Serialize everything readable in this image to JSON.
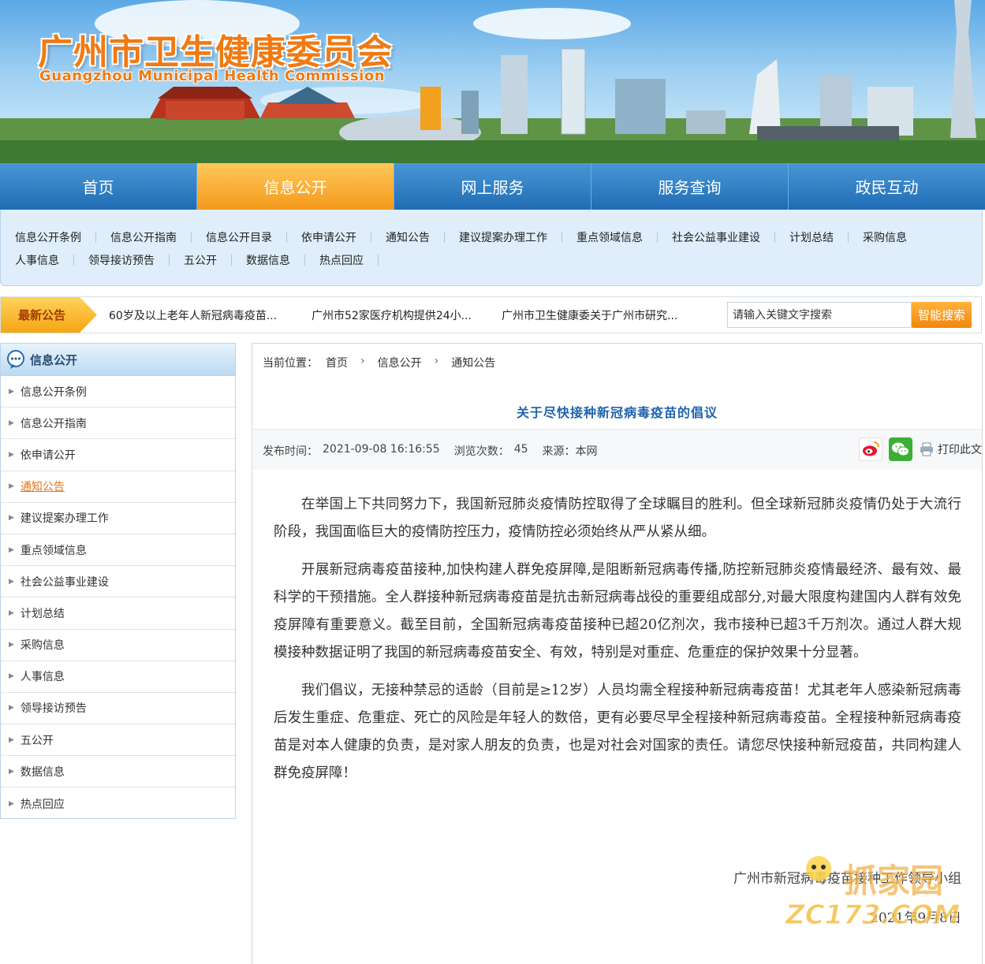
{
  "header": {
    "title_cn": "广州市卫生健康委员会",
    "title_en": "Guangzhou Municipal Health Commission"
  },
  "main_nav": [
    {
      "label": "首页",
      "active": false
    },
    {
      "label": "信息公开",
      "active": true
    },
    {
      "label": "网上服务",
      "active": false
    },
    {
      "label": "服务查询",
      "active": false
    },
    {
      "label": "政民互动",
      "active": false
    }
  ],
  "sub_nav": {
    "row1": [
      "信息公开条例",
      "信息公开指南",
      "信息公开目录",
      "依申请公开",
      "通知公告",
      "建议提案办理工作",
      "重点领域信息",
      "社会公益事业建设",
      "计划总结",
      "采购信息"
    ],
    "row2": [
      "人事信息",
      "领导接访预告",
      "五公开",
      "数据信息",
      "热点回应"
    ]
  },
  "notice": {
    "tag": "最新公告",
    "items": [
      "60岁及以上老年人新冠病毒疫苗...",
      "广州市52家医疗机构提供24小...",
      "广州市卫生健康委关于广州市研究..."
    ],
    "search_placeholder": "请输入关键文字搜索",
    "search_button": "智能搜索"
  },
  "sidebar": {
    "title": "信息公开",
    "items": [
      "信息公开条例",
      "信息公开指南",
      "依申请公开",
      "通知公告",
      "建议提案办理工作",
      "重点领域信息",
      "社会公益事业建设",
      "计划总结",
      "采购信息",
      "人事信息",
      "领导接访预告",
      "五公开",
      "数据信息",
      "热点回应"
    ],
    "active_index": 3
  },
  "breadcrumb": {
    "label": "当前位置：",
    "items": [
      "首页",
      "信息公开",
      "通知公告"
    ],
    "separator": "›"
  },
  "article": {
    "title": "关于尽快接种新冠病毒疫苗的倡议",
    "meta": {
      "time_label": "发布时间：",
      "time": "2021-09-08 16:16:55",
      "views_label": "浏览次数：",
      "views": "45",
      "source_label": "来源：",
      "source": "本网"
    },
    "print_label": "打印此文",
    "paragraphs": [
      "在举国上下共同努力下，我国新冠肺炎疫情防控取得了全球瞩目的胜利。但全球新冠肺炎疫情仍处于大流行阶段，我国面临巨大的疫情防控压力，疫情防控必须始终从严从紧从细。",
      "开展新冠病毒疫苗接种,加快构建人群免疫屏障,是阻断新冠病毒传播,防控新冠肺炎疫情最经济、最有效、最科学的干预措施。全人群接种新冠病毒疫苗是抗击新冠病毒战役的重要组成部分,对最大限度构建国内人群有效免疫屏障有重要意义。截至目前，全国新冠病毒疫苗接种已超20亿剂次，我市接种已超3千万剂次。通过人群大规模接种数据证明了我国的新冠病毒疫苗安全、有效，特别是对重症、危重症的保护效果十分显著。",
      "我们倡议，无接种禁忌的适龄（目前是≥12岁）人员均需全程接种新冠病毒疫苗！尤其老年人感染新冠病毒后发生重症、危重症、死亡的风险是年轻人的数倍，更有必要尽早全程接种新冠病毒疫苗。全程接种新冠病毒疫苗是对本人健康的负责，是对家人朋友的负责，也是对社会对国家的责任。请您尽快接种新冠疫苗，共同构建人群免疫屏障！"
    ],
    "signature": "广州市新冠病毒疫苗接种工作领导小组",
    "date": "2021年9月8日"
  },
  "watermark": {
    "text": "ZC173.COM"
  },
  "colors": {
    "brand_orange": "#f07a12",
    "nav_blue": "#1f6cb4",
    "title_blue": "#1f63ac"
  }
}
